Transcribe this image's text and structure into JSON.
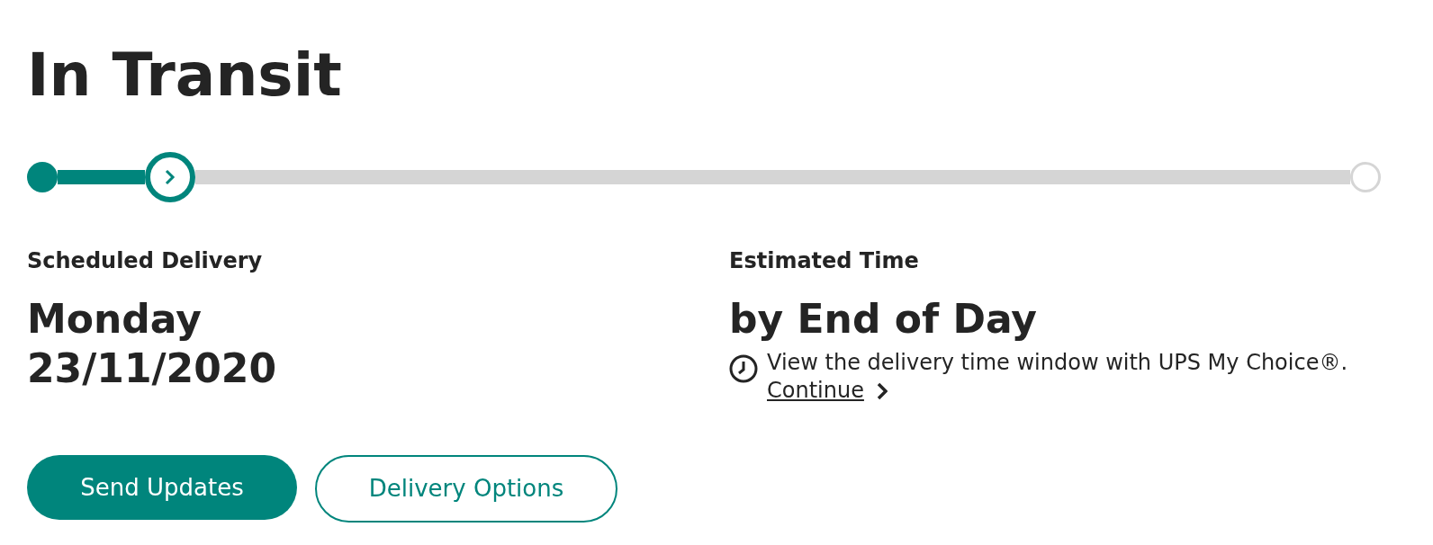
{
  "title": "In Transit",
  "progress": {
    "level": 0.087
  },
  "scheduled": {
    "label": "Scheduled Delivery",
    "day": "Monday",
    "date": "23/11/2020"
  },
  "estimated": {
    "label": "Estimated Time",
    "value": "by End of Day",
    "note": "View the delivery time window with UPS My Choice®.",
    "link": "Continue"
  },
  "buttons": [
    {
      "label": "Send Updates",
      "kind": "primary"
    },
    {
      "label": "Delivery Options",
      "kind": "secondary"
    }
  ]
}
